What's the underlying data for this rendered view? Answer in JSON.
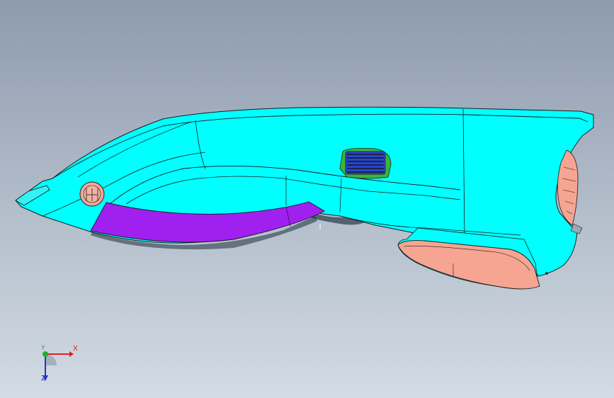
{
  "viewport": {
    "background_top": "#8e9bae",
    "background_bottom": "#d3dbe4"
  },
  "model": {
    "shell_color": "#00ffff",
    "grip_color": "#a020f0",
    "blade_guard_color": "#f5a592",
    "vent_color": "#2a45c8",
    "vent_border_color": "#3cb43c",
    "edge_color": "#1a1a1a"
  },
  "triad": {
    "x_label": "X",
    "y_label": "Y",
    "z_label": "Z",
    "x_color": "#e0201e",
    "y_color": "#20b030",
    "z_color": "#2038c8"
  }
}
